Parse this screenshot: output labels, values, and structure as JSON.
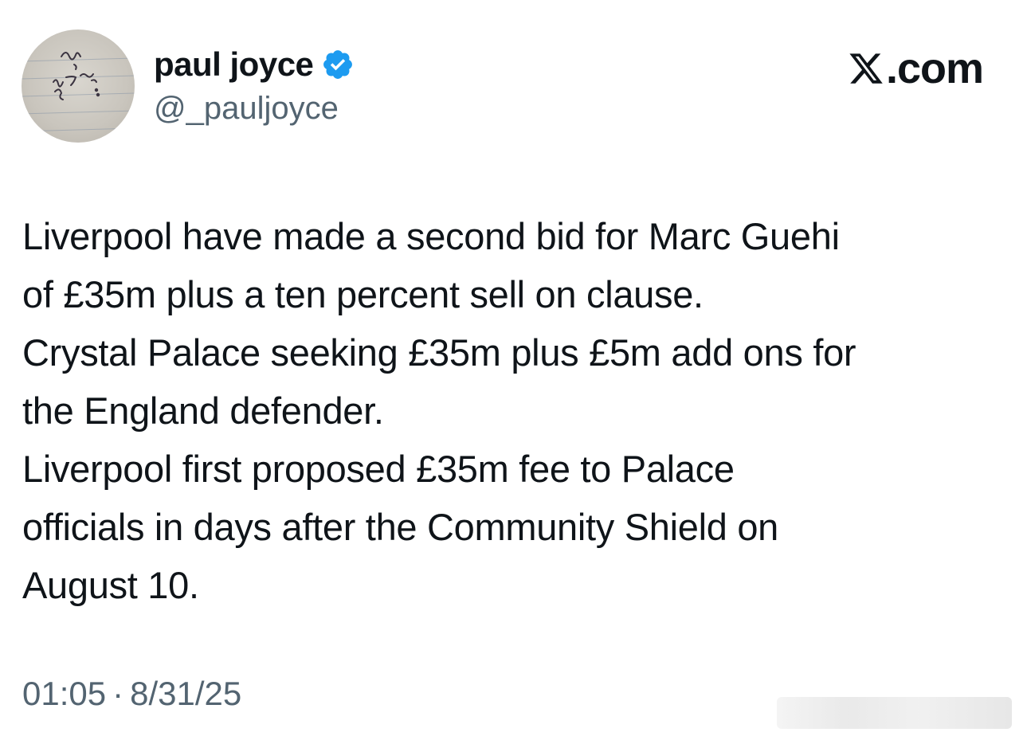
{
  "author": {
    "display_name": "paul joyce",
    "handle": "@_pauljoyce",
    "verified": true,
    "verified_color": "#1d9bf0",
    "avatar_icon": "handwriting-avatar"
  },
  "brand": {
    "logo_icon": "x-logo-icon",
    "text": ".com"
  },
  "tweet": {
    "lines": [
      "Liverpool have made a second bid for Marc Guehi",
      "of £35m plus a ten percent sell on clause.",
      "Crystal Palace seeking £35m plus £5m add ons for",
      "the England defender.",
      "Liverpool first proposed £35m fee to Palace",
      "officials in days after the Community Shield on",
      "August 10."
    ]
  },
  "meta": {
    "time": "01:05",
    "separator": "·",
    "date": "8/31/25"
  },
  "colors": {
    "text_primary": "#0f1419",
    "text_secondary": "#536471",
    "background": "#ffffff"
  }
}
